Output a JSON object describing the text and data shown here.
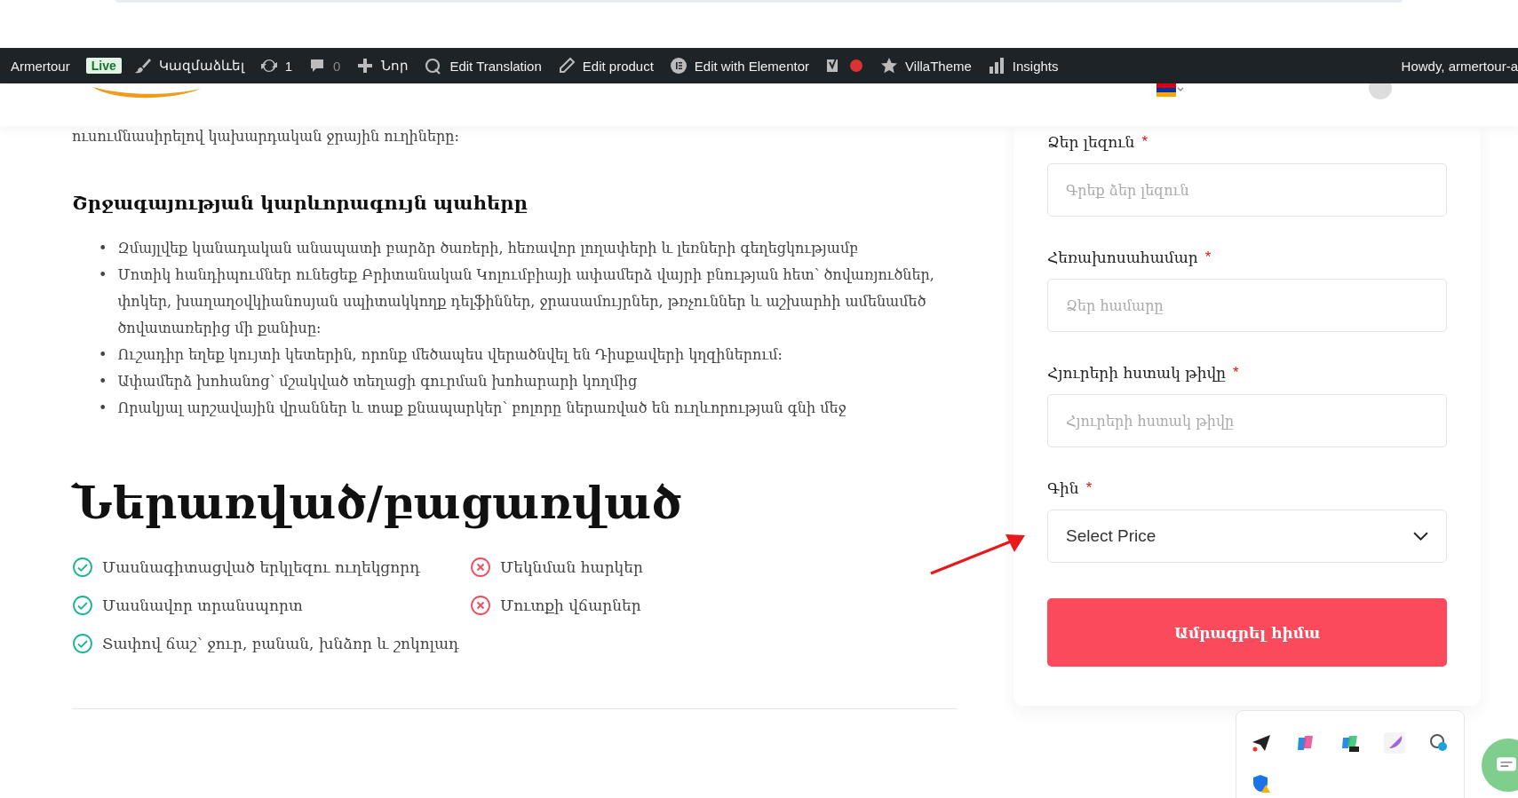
{
  "admin_bar": {
    "site": "Armertour",
    "live_badge": "Live",
    "customize": "Կազմաձևել",
    "updates": "1",
    "comments": "0",
    "new": "Նոր",
    "edit_translation": "Edit Translation",
    "edit_product": "Edit product",
    "edit_elementor": "Edit with Elementor",
    "villatheme": "VillaTheme",
    "insights": "Insights",
    "howdy": "Howdy, armertour-a"
  },
  "content": {
    "intro": "ուսումնասիրելով կախարդական ջրային ուղիները:",
    "highlights_title": "Շրջագայության կարևորագույն պահերը",
    "highlights": [
      {
        "marker": "•",
        "text": "Զմայլվեք կանադական անապատի բարձր ծառերի, հեռավոր լողափերի և լեռների գեղեցկությամբ"
      },
      {
        "marker": "•",
        "text": "Մոտիկ հանդիպումներ ունեցեք Բրիտանական Կոլումբիայի ափամերձ վայրի բնության հետ՝ ծովառյուծներ, փոկեր, խաղաղօվկիանոսյան սպիտակկողք դելֆիններ, ջրասամույրներ, թռչուններ և աշխարհի ամենամեծ ծովատառերից մի քանիսը:"
      },
      {
        "marker": "•",
        "text": "Ուշադիր եղեք կույտի կետերին, որոնք մեծապես վերածնվել են Դիսքավերի կղզիներում:"
      },
      {
        "marker": "•",
        "text": "Ափամերձ խոհանոց՝ մշակված տեղացի գուրման խոհարարի կողմից"
      },
      {
        "marker": "•",
        "text": "Որակյալ արշավային վրաններ և տաք քնապարկեր՝ բոլորը ներառված են ուղևորության գնի մեջ"
      }
    ],
    "included_title": "Ներառված/բացառված",
    "included": [
      {
        "label": "Մասնագիտացված երկլեզու ուղեկցորդ",
        "kind": "included"
      },
      {
        "label": "Մասնավոր տրանսպորտ",
        "kind": "included"
      },
      {
        "label": "Տափով ճաշ՝ ջուր, բանան, խնձոր և շոկոլադ",
        "kind": "included"
      }
    ],
    "excluded": [
      {
        "label": "Մեկնման հարկեր",
        "kind": "excluded"
      },
      {
        "label": "Մուտքի վճարներ",
        "kind": "excluded"
      }
    ]
  },
  "form": {
    "fields": [
      {
        "label": "Ձեր լեզուն",
        "required_mark": "*",
        "placeholder": "Գրեք ձեր լեզուն",
        "kind": "text"
      },
      {
        "label": "Հեռախոսահամար",
        "required_mark": "*",
        "placeholder": "Ձեր համարը",
        "kind": "text"
      },
      {
        "label": "Հյուրերի հստակ թիվը",
        "required_mark": "*",
        "placeholder": "Հյուրերի հստակ թիվը",
        "kind": "text"
      },
      {
        "label": "Գին",
        "required_mark": "*",
        "value": "Select Price",
        "kind": "select"
      }
    ],
    "submit": "Ամրագրել հիմա"
  }
}
